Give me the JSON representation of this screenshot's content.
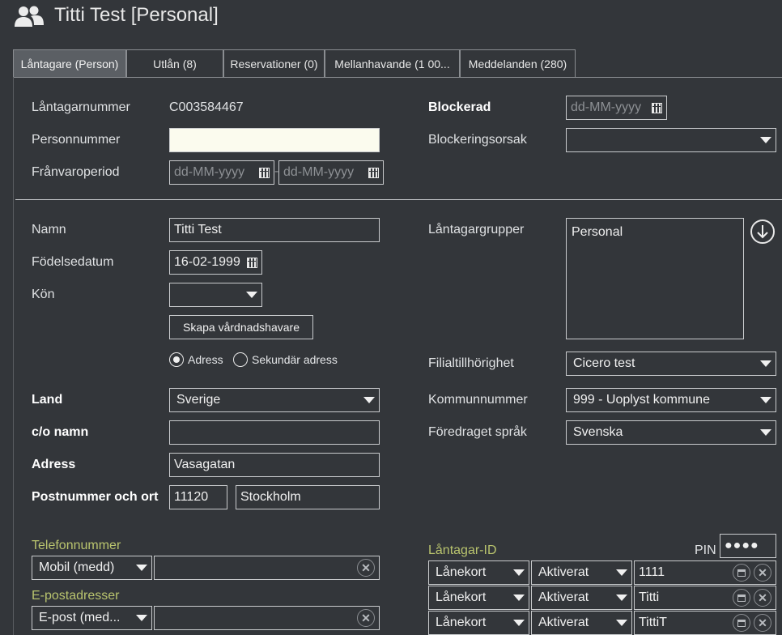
{
  "header": {
    "title": "Titti Test [Personal]",
    "icon": "users-icon"
  },
  "tabs": [
    {
      "label": "Låntagare (Person)",
      "active": true
    },
    {
      "label": "Utlån (8)",
      "active": false
    },
    {
      "label": "Reservationer (0)",
      "active": false
    },
    {
      "label": "Mellanhavande (1 00...",
      "active": false
    },
    {
      "label": "Meddelanden (280)",
      "active": false
    }
  ],
  "top": {
    "borrower_number_label": "Låntagarnummer",
    "borrower_number": "C003584467",
    "personal_number_label": "Personnummer",
    "personal_number": "",
    "absence_label": "Frånvaroperiod",
    "absence_from_placeholder": "dd-MM-yyyy",
    "absence_to_placeholder": "dd-MM-yyyy",
    "absence_separator": "-",
    "blocked_label": "Blockerad",
    "blocked_placeholder": "dd-MM-yyyy",
    "block_reason_label": "Blockeringsorsak",
    "block_reason": ""
  },
  "person": {
    "name_label": "Namn",
    "name": "Titti Test",
    "birthdate_label": "Födelsedatum",
    "birthdate": "16-02-1999",
    "gender_label": "Kön",
    "gender": "",
    "create_guardian_button": "Skapa vårdnadshavare",
    "address_radio": "Adress",
    "secondary_address_radio": "Sekundär adress",
    "address_selected": "Adress",
    "country_label": "Land",
    "country": "Sverige",
    "co_label": "c/o namn",
    "co": "",
    "address_label": "Adress",
    "address": "Vasagatan",
    "postal_label": "Postnummer och ort",
    "postal_code": "11120",
    "city": "Stockholm"
  },
  "right": {
    "groups_label": "Låntagargrupper",
    "groups": [
      "Personal"
    ],
    "branch_label": "Filialtillhörighet",
    "branch": "Cicero test",
    "municipality_label": "Kommunnummer",
    "municipality": "999 - Uoplyst kommune",
    "language_label": "Föredraget språk",
    "language": "Svenska"
  },
  "contacts": {
    "phone_heading": "Telefonnummer",
    "phone_type": "Mobil (medd)",
    "phone_value": "",
    "email_heading": "E-postadresser",
    "email_type": "E-post (med...",
    "email_value": ""
  },
  "borrower_ids": {
    "heading": "Låntagar-ID",
    "pin_label": "PIN",
    "pin_value": "●●●●",
    "rows": [
      {
        "type": "Lånekort",
        "status": "Aktiverat",
        "id": "1111"
      },
      {
        "type": "Lånekort",
        "status": "Aktiverat",
        "id": "Titti"
      },
      {
        "type": "Lånekort",
        "status": "Aktiverat",
        "id": "TittiT"
      }
    ]
  },
  "colors": {
    "background": "#33363a",
    "accent_green": "#b9c46e",
    "active_tab": "#5b5f64"
  }
}
